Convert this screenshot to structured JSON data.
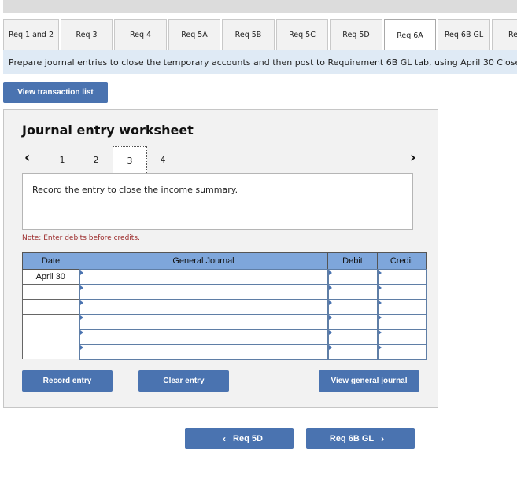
{
  "tabs": [
    {
      "label": "Req 1 and 2",
      "active": false
    },
    {
      "label": "Req 3",
      "active": false
    },
    {
      "label": "Req 4",
      "active": false
    },
    {
      "label": "Req 5A",
      "active": false
    },
    {
      "label": "Req 5B",
      "active": false
    },
    {
      "label": "Req 5C",
      "active": false
    },
    {
      "label": "Req 5D",
      "active": false
    },
    {
      "label": "Req 6A",
      "active": true
    },
    {
      "label": "Req 6B GL",
      "active": false
    },
    {
      "label": "Re",
      "active": false
    }
  ],
  "instruction": "Prepare journal entries to close the temporary accounts and then post to Requirement 6B GL tab, using April 30 Close",
  "view_transaction_list_label": "View transaction list",
  "worksheet": {
    "title": "Journal entry worksheet",
    "pager": {
      "prev_icon": "‹",
      "next_icon": "›",
      "pages": [
        "1",
        "2",
        "3",
        "4"
      ],
      "current_page": "3"
    },
    "prompt": "Record the entry to close the income summary.",
    "note": "Note: Enter debits before credits.",
    "table": {
      "headers": {
        "date": "Date",
        "general_journal": "General Journal",
        "debit": "Debit",
        "credit": "Credit"
      },
      "rows": [
        {
          "date": "April 30",
          "account": "",
          "debit": "",
          "credit": ""
        },
        {
          "date": "",
          "account": "",
          "debit": "",
          "credit": ""
        },
        {
          "date": "",
          "account": "",
          "debit": "",
          "credit": ""
        },
        {
          "date": "",
          "account": "",
          "debit": "",
          "credit": ""
        },
        {
          "date": "",
          "account": "",
          "debit": "",
          "credit": ""
        },
        {
          "date": "",
          "account": "",
          "debit": "",
          "credit": ""
        }
      ]
    },
    "buttons": {
      "record": "Record entry",
      "clear": "Clear entry",
      "view_general_journal": "View general journal"
    }
  },
  "navigation": {
    "prev_label": "Req 5D",
    "next_label": "Req 6B GL",
    "prev_icon": "‹",
    "next_icon": "›"
  }
}
